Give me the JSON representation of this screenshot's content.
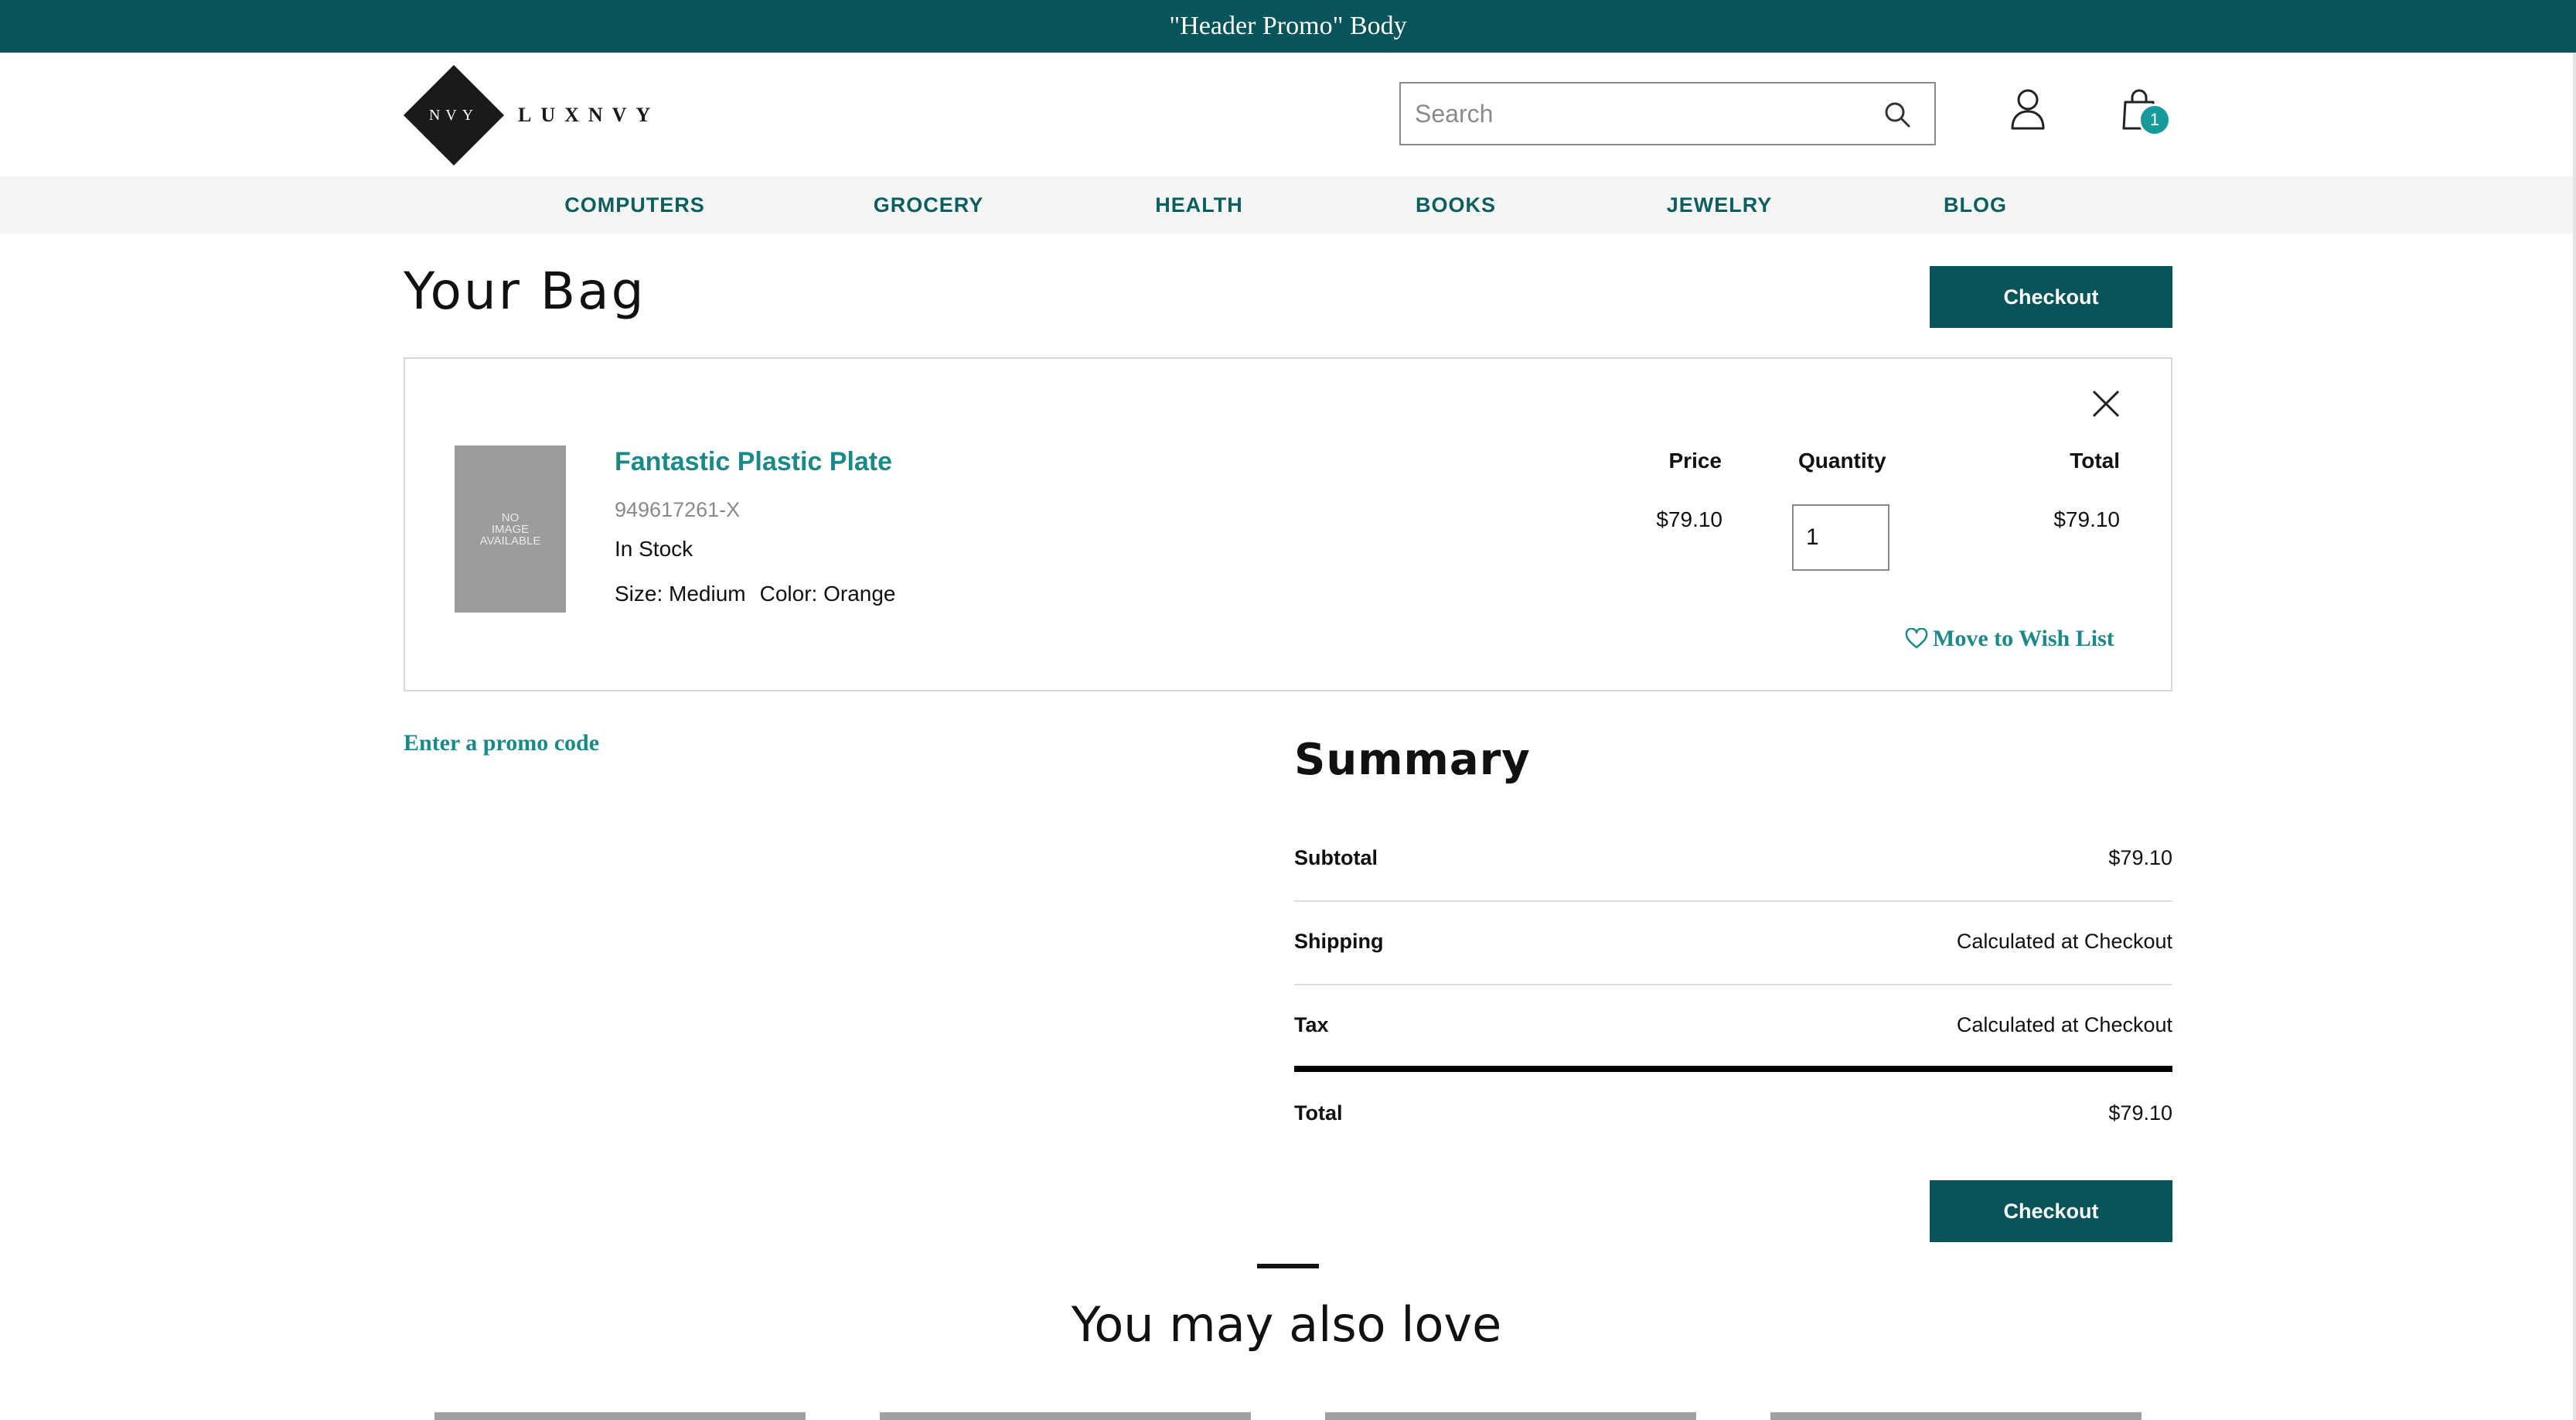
{
  "promo": {
    "text": "\"Header Promo\" Body"
  },
  "brand": {
    "mark": "NVY",
    "name": "LUXNVY"
  },
  "search": {
    "placeholder": "Search",
    "value": ""
  },
  "cart_count": "1",
  "nav": [
    "COMPUTERS",
    "GROCERY",
    "HEALTH",
    "BOOKS",
    "JEWELRY",
    "BLOG"
  ],
  "page": {
    "title": "Your Bag",
    "checkout_label": "Checkout"
  },
  "item": {
    "image_text": [
      "NO",
      "IMAGE",
      "AVAILABLE"
    ],
    "name": "Fantastic Plastic Plate",
    "sku": "949617261-X",
    "stock": "In Stock",
    "size": "Size: Medium",
    "color": "Color: Orange",
    "price_label": "Price",
    "quantity_label": "Quantity",
    "total_label": "Total",
    "price": "$79.10",
    "quantity": "1",
    "total": "$79.10",
    "wishlist_label": "Move to Wish List"
  },
  "promo_code": {
    "label": "Enter a promo code"
  },
  "summary": {
    "title": "Summary",
    "rows": [
      {
        "label": "Subtotal",
        "value": "$79.10"
      },
      {
        "label": "Shipping",
        "value": "Calculated at Checkout"
      },
      {
        "label": "Tax",
        "value": "Calculated at Checkout"
      },
      {
        "label": "Total",
        "value": "$79.10"
      }
    ],
    "checkout_label": "Checkout"
  },
  "recommendations": {
    "title": "You may also love"
  },
  "colors": {
    "brand_dark": "#07545a",
    "accent_teal": "#198a8a",
    "badge": "#169a9a"
  },
  "icons": [
    "search-icon",
    "account-icon",
    "bag-icon",
    "close-icon",
    "heart-icon"
  ]
}
